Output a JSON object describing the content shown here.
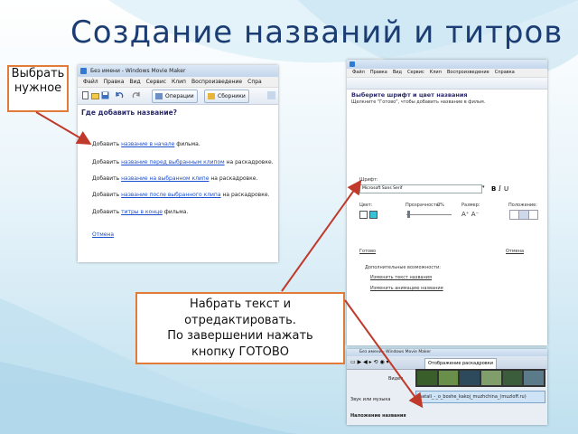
{
  "slide": {
    "title": "Создание названий и титров",
    "callout_select": "Выбрать нужное",
    "callout_instructions": [
      "Набрать текст и",
      "отредактировать.",
      "По завершении нажать",
      "кнопку ГОТОВО"
    ]
  },
  "window1": {
    "title": "Без имени - Windows Movie Maker",
    "menu": [
      "Файл",
      "Правка",
      "Вид",
      "Сервис",
      "Клип",
      "Воспроизведение",
      "Спра"
    ],
    "toolbar": {
      "operations": "Операции",
      "collections": "Сборники"
    },
    "heading": "Где добавить название?",
    "options": [
      {
        "prefix": "Добавить ",
        "link": "название в начале",
        "suffix": " фильма."
      },
      {
        "prefix": "Добавить ",
        "link": "название перед выбранным клипом",
        "suffix": " на раскадровке."
      },
      {
        "prefix": "Добавить ",
        "link": "название на выбранном клипе",
        "suffix": " на раскадровке."
      },
      {
        "prefix": "Добавить ",
        "link": "название после выбранного клипа",
        "suffix": " на раскадровке."
      },
      {
        "prefix": "Добавить ",
        "link": "титры в конце",
        "suffix": " фильма."
      }
    ],
    "cancel": "Отмена"
  },
  "window2": {
    "menu": [
      "Файл",
      "Правка",
      "Вид",
      "Сервис",
      "Клип",
      "Воспроизведение",
      "Справка"
    ],
    "heading": "Выберите шрифт и цвет названия",
    "hint": "Щелкните \"Готово\", чтобы добавить название в фильм.",
    "font_label": "Шрифт:",
    "font_value": "Microsoft Sans Serif",
    "color_label": "Цвет:",
    "transparency_label": "Прозрачность:",
    "transparency_value": "0%",
    "size_label": "Размер:",
    "position_label": "Положение:",
    "done": "Готово",
    "cancel": "Отмена",
    "more_options": "Дополнительные возможности:",
    "change_text": "Изменить текст названия",
    "change_animation": "Изменить анимацию названия"
  },
  "window3": {
    "title": "Без имени - Windows Movie Maker",
    "timeline_label": "Отображение раскадровки",
    "track_video": "Видео",
    "track_audio": "Звук или музыка",
    "track_titles": "Наложение названия",
    "audio_clip": "natali_-_o_boshe_kakoj_muzhchina_(muzloff.ru)"
  },
  "colors": {
    "title": "#1b3d73",
    "callout_border": "#e07b39",
    "arrow": "#c0392b",
    "link": "#1a4fd0"
  }
}
